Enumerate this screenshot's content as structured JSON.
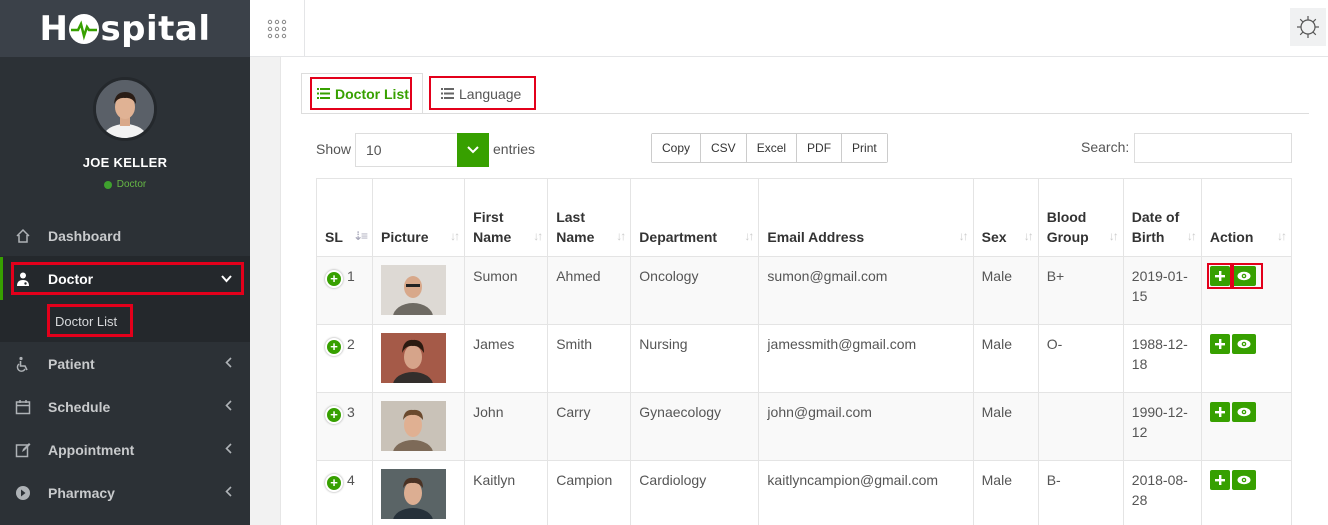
{
  "app": {
    "logo_text": "Hospital"
  },
  "user": {
    "name": "JOE KELLER",
    "role": "Doctor"
  },
  "menu": [
    {
      "label": "Dashboard",
      "icon": "home-icon"
    },
    {
      "label": "Doctor",
      "icon": "user-md-icon",
      "active": true
    },
    {
      "label": "Patient",
      "icon": "wheelchair-icon"
    },
    {
      "label": "Schedule",
      "icon": "calendar-icon"
    },
    {
      "label": "Appointment",
      "icon": "edit-icon"
    },
    {
      "label": "Pharmacy",
      "icon": "arrow-circle-icon"
    }
  ],
  "submenu": {
    "doctor_list": "Doctor List"
  },
  "tabs": {
    "doctor_list": "Doctor List",
    "language": "Language"
  },
  "controls": {
    "show": "Show",
    "page_size": "10",
    "entries": "entries",
    "search_label": "Search:",
    "buttons": [
      "Copy",
      "CSV",
      "Excel",
      "PDF",
      "Print"
    ]
  },
  "table": {
    "headers": [
      "SL",
      "Picture",
      "First Name",
      "Last Name",
      "Department",
      "Email Address",
      "Sex",
      "Blood Group",
      "Date of Birth",
      "Action"
    ],
    "rows": [
      {
        "sl": "1",
        "first": "Sumon",
        "last": "Ahmed",
        "dept": "Oncology",
        "email": "sumon@gmail.com",
        "sex": "Male",
        "blood": "B+",
        "dob": "2019-01-15"
      },
      {
        "sl": "2",
        "first": "James",
        "last": "Smith",
        "dept": "Nursing",
        "email": "jamessmith@gmail.com",
        "sex": "Male",
        "blood": "O-",
        "dob": "1988-12-18"
      },
      {
        "sl": "3",
        "first": "John",
        "last": "Carry",
        "dept": "Gynaecology",
        "email": "john@gmail.com",
        "sex": "Male",
        "blood": "",
        "dob": "1990-12-12"
      },
      {
        "sl": "4",
        "first": "Kaitlyn",
        "last": "Campion",
        "dept": "Cardiology",
        "email": "kaitlyncampion@gmail.com",
        "sex": "Male",
        "blood": "B-",
        "dob": "2018-08-28"
      }
    ]
  },
  "colors": {
    "accent": "#37a000",
    "sidebar": "#2c3136",
    "highlight": "#e3001b"
  }
}
